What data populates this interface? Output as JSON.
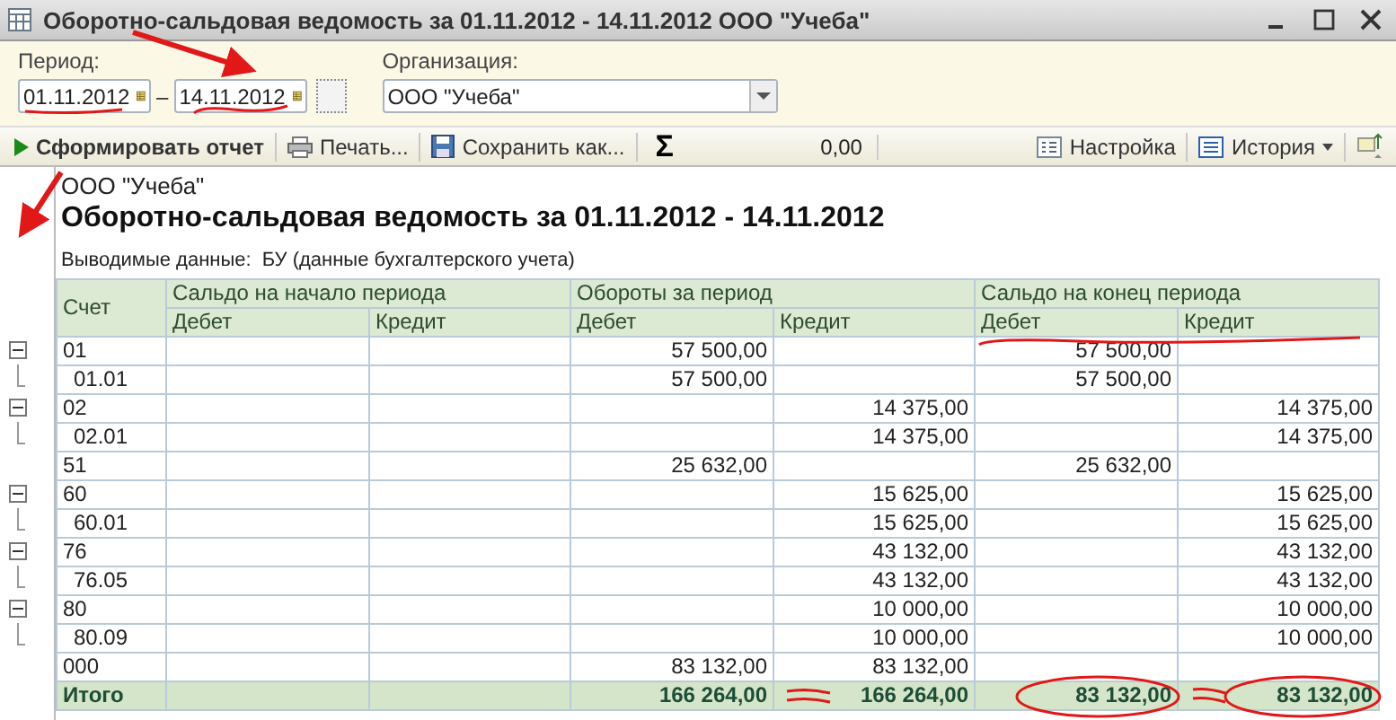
{
  "window": {
    "title": "Оборотно-сальдовая ведомость за 01.11.2012 - 14.11.2012 ООО \"Учеба\""
  },
  "form": {
    "period_label": "Период:",
    "date_from": "01.11.2012",
    "separator": "–",
    "date_to": "14.11.2012",
    "organization_label": "Организация:",
    "organization": "ООО \"Учеба\""
  },
  "toolbar": {
    "generate": "Сформировать отчет",
    "print": "Печать...",
    "save": "Сохранить как...",
    "sum_symbol": "Σ",
    "sum_value": "0,00",
    "settings": "Настройка",
    "history": "История"
  },
  "report": {
    "organization": "ООО \"Учеба\"",
    "title": "Оборотно-сальдовая ведомость за 01.11.2012 - 14.11.2012",
    "data_label": "Выводимые данные:",
    "data_value": "БУ (данные бухгалтерского учета)"
  },
  "table": {
    "account_header": "Счет",
    "column_groups": [
      "Сальдо на начало периода",
      "Обороты за период",
      "Сальдо на конец периода"
    ],
    "subcolumns": [
      "Дебет",
      "Кредит",
      "Дебет",
      "Кредит",
      "Дебет",
      "Кредит"
    ],
    "rows": [
      {
        "account": "01",
        "turnover_debit": "57 500,00",
        "closing_debit": "57 500,00",
        "expanded": true,
        "children": [
          {
            "account": "01.01",
            "turnover_debit": "57 500,00",
            "closing_debit": "57 500,00"
          }
        ]
      },
      {
        "account": "02",
        "turnover_credit": "14 375,00",
        "closing_credit": "14 375,00",
        "expanded": true,
        "children": [
          {
            "account": "02.01",
            "turnover_credit": "14 375,00",
            "closing_credit": "14 375,00"
          }
        ]
      },
      {
        "account": "51",
        "turnover_debit": "25 632,00",
        "closing_debit": "25 632,00"
      },
      {
        "account": "60",
        "turnover_credit": "15 625,00",
        "closing_credit": "15 625,00",
        "expanded": true,
        "children": [
          {
            "account": "60.01",
            "turnover_credit": "15 625,00",
            "closing_credit": "15 625,00"
          }
        ]
      },
      {
        "account": "76",
        "turnover_credit": "43 132,00",
        "closing_credit": "43 132,00",
        "expanded": true,
        "children": [
          {
            "account": "76.05",
            "turnover_credit": "43 132,00",
            "closing_credit": "43 132,00"
          }
        ]
      },
      {
        "account": "80",
        "turnover_credit": "10 000,00",
        "closing_credit": "10 000,00",
        "expanded": true,
        "children": [
          {
            "account": "80.09",
            "turnover_credit": "10 000,00",
            "closing_credit": "10 000,00"
          }
        ]
      },
      {
        "account": "000",
        "turnover_debit": "83 132,00",
        "turnover_credit": "83 132,00"
      }
    ],
    "total": {
      "label": "Итого",
      "turnover_debit": "166 264,00",
      "turnover_credit": "166 264,00",
      "closing_debit": "83 132,00",
      "closing_credit": "83 132,00"
    }
  }
}
